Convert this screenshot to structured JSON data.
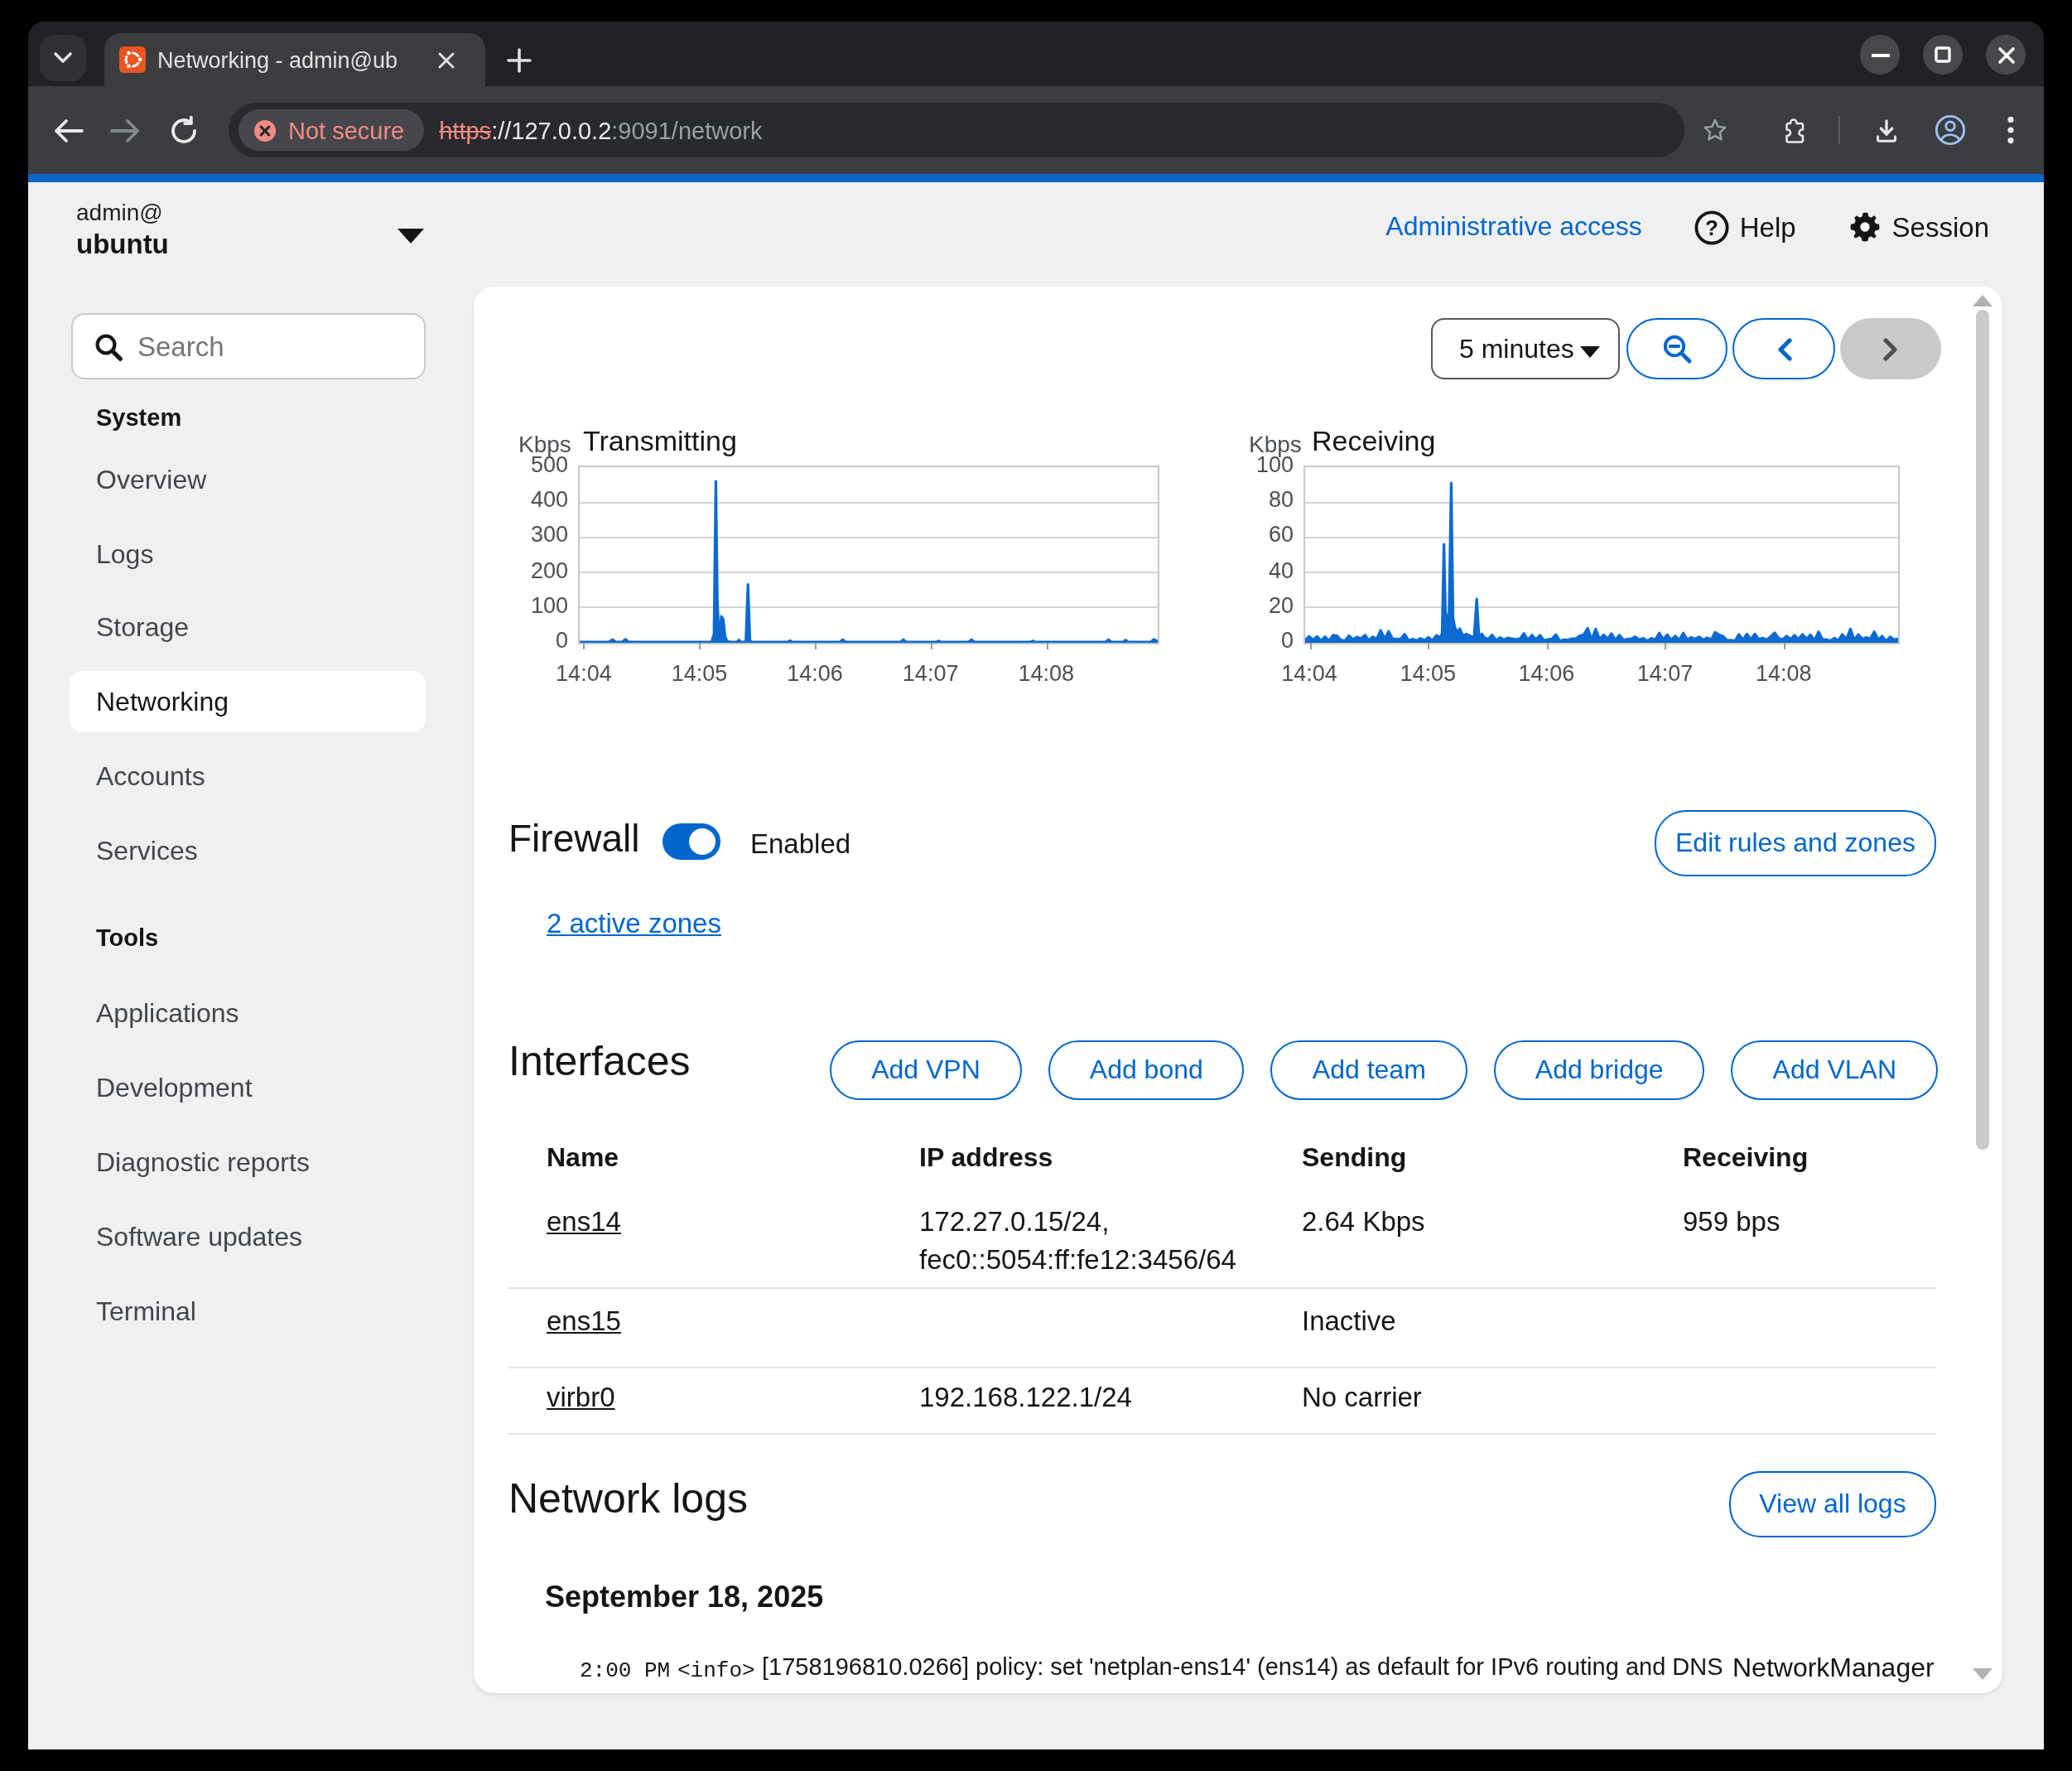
{
  "browser": {
    "tab": {
      "title": "Networking - admin@ub",
      "favicon": "ubuntu-logo"
    },
    "new_tab_label": "+",
    "window_controls": {
      "minimize": "minimize",
      "maximize": "maximize",
      "close": "close"
    },
    "security_badge": "Not secure",
    "url": {
      "scheme": "https",
      "separator": "://",
      "host": "127.0.0.2",
      "rest": ":9091/network"
    }
  },
  "masthead": {
    "user_line1": "admin@",
    "user_line2": "ubuntu",
    "admin_access": "Administrative access",
    "help": "Help",
    "session": "Session"
  },
  "sidebar": {
    "search_placeholder": "Search",
    "sections": [
      {
        "heading": "System",
        "items": [
          "Overview",
          "Logs",
          "Storage",
          "Networking",
          "Accounts",
          "Services"
        ]
      },
      {
        "heading": "Tools",
        "items": [
          "Applications",
          "Development",
          "Diagnostic reports",
          "Software updates",
          "Terminal"
        ]
      }
    ],
    "selected_item": "Networking"
  },
  "content": {
    "controls": {
      "interval": "5 minutes"
    },
    "firewall": {
      "title": "Firewall",
      "state": "Enabled",
      "edit_button": "Edit rules and zones",
      "zones_link": "2 active zones"
    },
    "interfaces": {
      "title": "Interfaces",
      "buttons": [
        "Add VPN",
        "Add bond",
        "Add team",
        "Add bridge",
        "Add VLAN"
      ],
      "table": {
        "headers": [
          "Name",
          "IP address",
          "Sending",
          "Receiving"
        ],
        "rows": [
          {
            "name": "ens14",
            "ip1": "172.27.0.15/24,",
            "ip2": "fec0::5054:ff:fe12:3456/64",
            "sending": "2.64 Kbps",
            "receiving": "959 bps"
          },
          {
            "name": "ens15",
            "ip1": "",
            "ip2": "",
            "sending": "Inactive",
            "receiving": ""
          },
          {
            "name": "virbr0",
            "ip1": "192.168.122.1/24",
            "ip2": "",
            "sending": "No carrier",
            "receiving": ""
          }
        ]
      }
    },
    "network_logs": {
      "title": "Network logs",
      "view_all_button": "View all logs",
      "date": "September 18, 2025",
      "entries": [
        {
          "time": "2:00 PM",
          "level": "<info>",
          "message": "[1758196810.0266] policy: set 'netplan-ens14' (ens14) as default for IPv6 routing and DNS",
          "service": "NetworkManager"
        }
      ]
    }
  },
  "chart_data": [
    {
      "type": "area",
      "title": "Transmitting",
      "unit": "Kbps",
      "ylim": [
        0,
        500
      ],
      "yticks": [
        "500",
        "400",
        "300",
        "200",
        "100",
        "0"
      ],
      "xticks": [
        "14:04",
        "14:05",
        "14:06",
        "14:07",
        "14:08"
      ],
      "xtick_fracs": [
        0.007,
        0.207,
        0.407,
        0.607,
        0.807
      ],
      "grid": true,
      "series": [
        [
          0,
          2
        ],
        [
          0.05,
          2
        ],
        [
          0.057,
          9
        ],
        [
          0.063,
          2
        ],
        [
          0.073,
          2
        ],
        [
          0.079,
          10
        ],
        [
          0.085,
          2
        ],
        [
          0.12,
          2
        ],
        [
          0.18,
          2
        ],
        [
          0.228,
          2
        ],
        [
          0.2325,
          25
        ],
        [
          0.2355,
          460
        ],
        [
          0.238,
          130
        ],
        [
          0.24,
          35
        ],
        [
          0.2425,
          22
        ],
        [
          0.245,
          75
        ],
        [
          0.248,
          68
        ],
        [
          0.2515,
          18
        ],
        [
          0.255,
          4
        ],
        [
          0.262,
          2
        ],
        [
          0.272,
          2
        ],
        [
          0.2755,
          8
        ],
        [
          0.279,
          2
        ],
        [
          0.2875,
          2
        ],
        [
          0.291,
          166
        ],
        [
          0.2945,
          6
        ],
        [
          0.298,
          2
        ],
        [
          0.36,
          2
        ],
        [
          0.364,
          6
        ],
        [
          0.368,
          2
        ],
        [
          0.45,
          2
        ],
        [
          0.455,
          9
        ],
        [
          0.46,
          2
        ],
        [
          0.555,
          2
        ],
        [
          0.56,
          9
        ],
        [
          0.565,
          2
        ],
        [
          0.617,
          2
        ],
        [
          0.621,
          5
        ],
        [
          0.625,
          2
        ],
        [
          0.672,
          2
        ],
        [
          0.678,
          9
        ],
        [
          0.683,
          2
        ],
        [
          0.78,
          2
        ],
        [
          0.784,
          5
        ],
        [
          0.788,
          2
        ],
        [
          0.91,
          2
        ],
        [
          0.915,
          9
        ],
        [
          0.92,
          2
        ],
        [
          0.94,
          2
        ],
        [
          0.944,
          8
        ],
        [
          0.949,
          2
        ],
        [
          0.988,
          2
        ],
        [
          0.993,
          10
        ],
        [
          1.0,
          4
        ]
      ]
    },
    {
      "type": "area",
      "title": "Receiving",
      "unit": "Kbps",
      "ylim": [
        0,
        100
      ],
      "yticks": [
        "100",
        "80",
        "60",
        "40",
        "20",
        "0"
      ],
      "xticks": [
        "14:04",
        "14:05",
        "14:06",
        "14:07",
        "14:08"
      ],
      "xtick_fracs": [
        0.007,
        0.207,
        0.407,
        0.607,
        0.807
      ],
      "grid": true,
      "series": [
        [
          0.0,
          1.6
        ],
        [
          0.0067,
          3.6
        ],
        [
          0.0134,
          1.8
        ],
        [
          0.0201,
          3.6
        ],
        [
          0.0268,
          1.1
        ],
        [
          0.0336,
          3.5
        ],
        [
          0.0403,
          1.1
        ],
        [
          0.047,
          4.3
        ],
        [
          0.0537,
          4.0
        ],
        [
          0.0604,
          1.6
        ],
        [
          0.0671,
          1.0
        ],
        [
          0.0738,
          4.1
        ],
        [
          0.0805,
          1.9
        ],
        [
          0.0872,
          3.3
        ],
        [
          0.094,
          2.4
        ],
        [
          0.1007,
          4.3
        ],
        [
          0.1074,
          1.3
        ],
        [
          0.1141,
          3.4
        ],
        [
          0.1208,
          2.2
        ],
        [
          0.1275,
          7.1
        ],
        [
          0.1342,
          2.3
        ],
        [
          0.1409,
          6.5
        ],
        [
          0.1477,
          2.1
        ],
        [
          0.1544,
          2.2
        ],
        [
          0.1611,
          2.1
        ],
        [
          0.1678,
          4.9
        ],
        [
          0.1745,
          1.2
        ],
        [
          0.1812,
          2.2
        ],
        [
          0.1879,
          1.2
        ],
        [
          0.1946,
          2.5
        ],
        [
          0.2013,
          1.4
        ],
        [
          0.2081,
          3.1
        ],
        [
          0.2148,
          1.3
        ],
        [
          0.2215,
          4.2
        ],
        [
          0.227,
          3
        ],
        [
          0.231,
          5
        ],
        [
          0.234,
          56
        ],
        [
          0.2365,
          18
        ],
        [
          0.239,
          14
        ],
        [
          0.2425,
          12
        ],
        [
          0.2465,
          91
        ],
        [
          0.2495,
          14
        ],
        [
          0.2525,
          9
        ],
        [
          0.256,
          6
        ],
        [
          0.261,
          8
        ],
        [
          0.266,
          4
        ],
        [
          0.272,
          5
        ],
        [
          0.278,
          4
        ],
        [
          0.285,
          3
        ],
        [
          0.2895,
          25
        ],
        [
          0.293,
          4
        ],
        [
          0.298,
          5
        ],
        [
          0.302,
          3.1
        ],
        [
          0.3087,
          2.1
        ],
        [
          0.3154,
          4.5
        ],
        [
          0.3221,
          1.3
        ],
        [
          0.3289,
          3.0
        ],
        [
          0.3356,
          1.7
        ],
        [
          0.3423,
          2.8
        ],
        [
          0.349,
          2.3
        ],
        [
          0.3557,
          2.0
        ],
        [
          0.3624,
          2.3
        ],
        [
          0.3691,
          5.3
        ],
        [
          0.3758,
          1.6
        ],
        [
          0.3826,
          4.3
        ],
        [
          0.3893,
          2.0
        ],
        [
          0.396,
          4.2
        ],
        [
          0.4027,
          1.2
        ],
        [
          0.4094,
          1.9
        ],
        [
          0.4161,
          2.2
        ],
        [
          0.4228,
          4.6
        ],
        [
          0.4295,
          1.0
        ],
        [
          0.4362,
          1.8
        ],
        [
          0.443,
          1.5
        ],
        [
          0.4497,
          2.4
        ],
        [
          0.4564,
          2.4
        ],
        [
          0.4631,
          4.0
        ],
        [
          0.4698,
          4.5
        ],
        [
          0.4765,
          8.3
        ],
        [
          0.4832,
          1.7
        ],
        [
          0.4899,
          7.8
        ],
        [
          0.4966,
          2.0
        ],
        [
          0.5034,
          4.5
        ],
        [
          0.5101,
          2.3
        ],
        [
          0.5168,
          5.2
        ],
        [
          0.5235,
          1.6
        ],
        [
          0.5302,
          4.3
        ],
        [
          0.5369,
          1.5
        ],
        [
          0.5436,
          2.1
        ],
        [
          0.5503,
          2.4
        ],
        [
          0.557,
          3.4
        ],
        [
          0.5638,
          1.8
        ],
        [
          0.5705,
          2.5
        ],
        [
          0.5772,
          1.0
        ],
        [
          0.5839,
          2.5
        ],
        [
          0.5906,
          1.7
        ],
        [
          0.5973,
          5.6
        ],
        [
          0.604,
          1.9
        ],
        [
          0.6107,
          4.6
        ],
        [
          0.6174,
          1.6
        ],
        [
          0.6242,
          3.9
        ],
        [
          0.6309,
          1.6
        ],
        [
          0.6376,
          5.6
        ],
        [
          0.6443,
          1.8
        ],
        [
          0.651,
          3.1
        ],
        [
          0.6577,
          2.2
        ],
        [
          0.6644,
          3.4
        ],
        [
          0.6711,
          1.6
        ],
        [
          0.6779,
          2.9
        ],
        [
          0.6846,
          1.7
        ],
        [
          0.6913,
          5.9
        ],
        [
          0.698,
          4.5
        ],
        [
          0.7047,
          3.8
        ],
        [
          0.7114,
          1.4
        ],
        [
          0.7181,
          1.5
        ],
        [
          0.7248,
          1.0
        ],
        [
          0.7315,
          4.8
        ],
        [
          0.7383,
          1.6
        ],
        [
          0.745,
          5.0
        ],
        [
          0.7517,
          2.0
        ],
        [
          0.7584,
          5.0
        ],
        [
          0.7651,
          2.0
        ],
        [
          0.7718,
          2.7
        ],
        [
          0.7785,
          1.7
        ],
        [
          0.7852,
          3.6
        ],
        [
          0.7919,
          5.7
        ],
        [
          0.7987,
          2.5
        ],
        [
          0.8054,
          1.9
        ],
        [
          0.8121,
          3.8
        ],
        [
          0.8188,
          2.1
        ],
        [
          0.8255,
          4.2
        ],
        [
          0.8322,
          2.0
        ],
        [
          0.8389,
          4.8
        ],
        [
          0.8456,
          2.3
        ],
        [
          0.8523,
          4.5
        ],
        [
          0.8591,
          1.4
        ],
        [
          0.8658,
          6.2
        ],
        [
          0.8725,
          1.8
        ],
        [
          0.8792,
          1.8
        ],
        [
          0.8859,
          1.1
        ],
        [
          0.8926,
          2.6
        ],
        [
          0.8993,
          1.2
        ],
        [
          0.906,
          4.7
        ],
        [
          0.9128,
          2.0
        ],
        [
          0.9195,
          7.8
        ],
        [
          0.9262,
          1.7
        ],
        [
          0.9329,
          4.7
        ],
        [
          0.9396,
          2.2
        ],
        [
          0.9463,
          3.0
        ],
        [
          0.953,
          2.3
        ],
        [
          0.9597,
          6.2
        ],
        [
          0.9664,
          1.8
        ],
        [
          0.9732,
          3.8
        ],
        [
          0.9799,
          1.0
        ],
        [
          0.9866,
          3.4
        ],
        [
          0.9933,
          1.8
        ],
        [
          1.0,
          2.2
        ]
      ]
    }
  ],
  "colors": {
    "accent_blue": "#0066cc",
    "chart_blue": "#0c6ad1",
    "top_bar_blue": "#0d65c8",
    "not_secure_red": "#f28b82",
    "page_bg": "#f0f0f1",
    "card_bg": "#ffffff"
  }
}
